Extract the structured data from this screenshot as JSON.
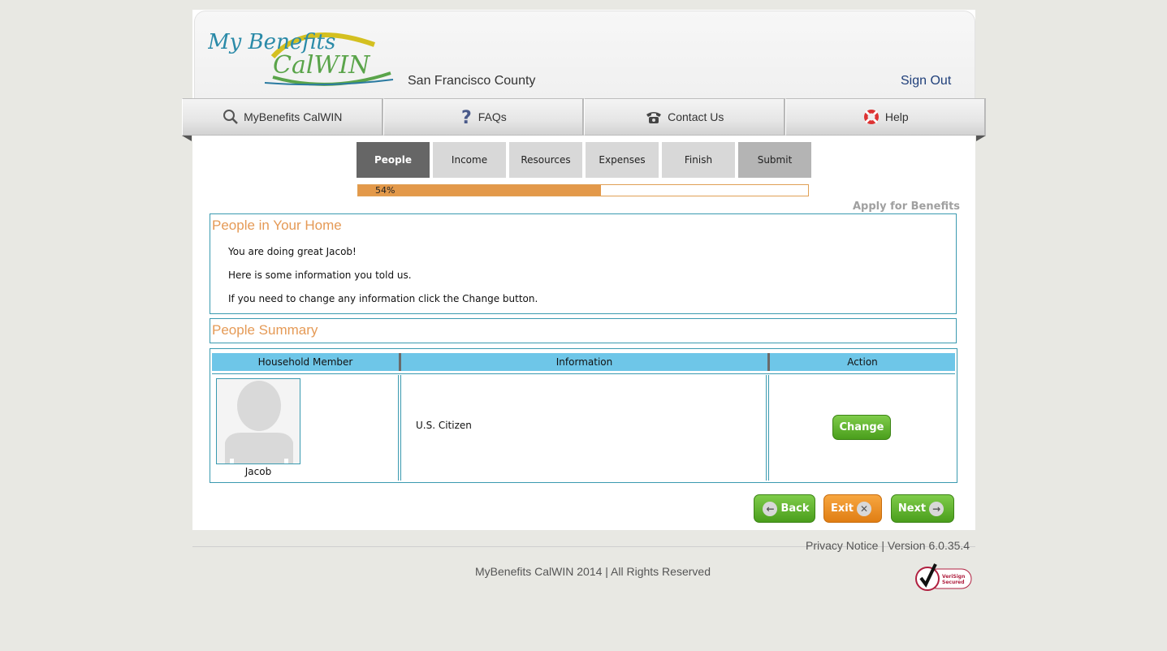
{
  "header": {
    "logo_text_top": "My Benefits",
    "logo_text_bottom": "CalWIN",
    "county": "San Francisco County",
    "sign_out": "Sign Out"
  },
  "nav": {
    "items": [
      {
        "label": "MyBenefits CalWIN",
        "icon": "search-icon"
      },
      {
        "label": "FAQs",
        "icon": "question-icon"
      },
      {
        "label": "Contact Us",
        "icon": "phone-icon"
      },
      {
        "label": "Help",
        "icon": "lifebuoy-icon"
      }
    ]
  },
  "steps": {
    "items": [
      "People",
      "Income",
      "Resources",
      "Expenses",
      "Finish",
      "Submit"
    ],
    "active": "People"
  },
  "progress": {
    "value": 0.54,
    "label": "54%"
  },
  "apply_title": "Apply for Benefits",
  "people_home": {
    "title": "People in Your Home",
    "lines": [
      "You are doing great Jacob!",
      "Here is some information you told us.",
      "If you need to change any information click the Change button."
    ]
  },
  "people_summary": {
    "title": "People Summary"
  },
  "table": {
    "headers": [
      "Household Member",
      "Information",
      "Action"
    ],
    "rows": [
      {
        "member": "Jacob",
        "information": "U.S. Citizen",
        "action": "Change"
      }
    ]
  },
  "buttons": {
    "back": "Back",
    "exit": "Exit",
    "next": "Next"
  },
  "footer": {
    "privacy": "Privacy Notice",
    "separator": "|",
    "version": "Version  6.0.35.4",
    "copyright": "MyBenefits CalWIN 2014 | All Rights Reserved",
    "verisign_text_1": "VeriSign",
    "verisign_text_2": "Secured"
  },
  "colors": {
    "accent_orange": "#e59a56",
    "progress_fill": "#e3994a",
    "table_header": "#6ec6e8",
    "border_teal": "#3a9ab0",
    "active_step": "#666666",
    "button_green": "#4a9e1c",
    "button_orange": "#e07e14"
  }
}
